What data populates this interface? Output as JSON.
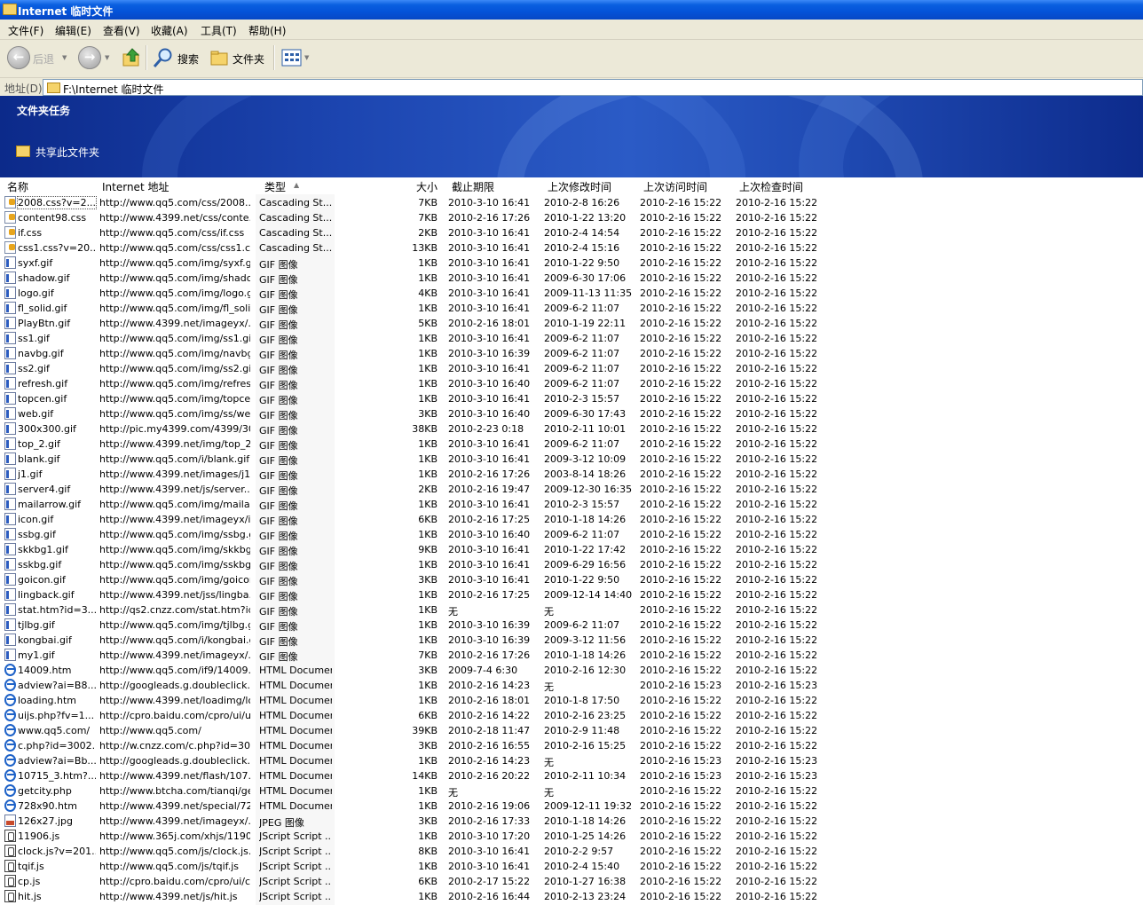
{
  "window": {
    "title": "Internet 临时文件"
  },
  "menu": [
    "文件(F)",
    "编辑(E)",
    "查看(V)",
    "收藏(A)",
    "工具(T)",
    "帮助(H)"
  ],
  "toolbar": {
    "back": "后退",
    "search": "搜索",
    "folders": "文件夹"
  },
  "address": {
    "label": "地址(D)",
    "value": "F:\\Internet 临时文件"
  },
  "tasks": {
    "title": "文件夹任务",
    "share": "共享此文件夹"
  },
  "columns": {
    "name": "名称",
    "address": "Internet 地址",
    "type": "类型",
    "size": "大小",
    "expires": "截止期限",
    "modified": "上次修改时间",
    "accessed": "上次访问时间",
    "checked": "上次检查时间"
  },
  "files": [
    {
      "icon": "css",
      "name": "2008.css?v=2...",
      "address": "http://www.qq5.com/css/2008....",
      "type": "Cascading St...",
      "size": "7KB",
      "expires": "2010-3-10 16:41",
      "modified": "2010-2-8 16:26",
      "accessed": "2010-2-16 15:22",
      "checked": "2010-2-16 15:22"
    },
    {
      "icon": "css",
      "name": "content98.css",
      "address": "http://www.4399.net/css/conte...",
      "type": "Cascading St...",
      "size": "7KB",
      "expires": "2010-2-16 17:26",
      "modified": "2010-1-22 13:20",
      "accessed": "2010-2-16 15:22",
      "checked": "2010-2-16 15:22"
    },
    {
      "icon": "css",
      "name": "if.css",
      "address": "http://www.qq5.com/css/if.css",
      "type": "Cascading St...",
      "size": "2KB",
      "expires": "2010-3-10 16:41",
      "modified": "2010-2-4 14:54",
      "accessed": "2010-2-16 15:22",
      "checked": "2010-2-16 15:22"
    },
    {
      "icon": "css",
      "name": "css1.css?v=20...",
      "address": "http://www.qq5.com/css/css1.c...",
      "type": "Cascading St...",
      "size": "13KB",
      "expires": "2010-3-10 16:41",
      "modified": "2010-2-4 15:16",
      "accessed": "2010-2-16 15:22",
      "checked": "2010-2-16 15:22"
    },
    {
      "icon": "gif",
      "name": "syxf.gif",
      "address": "http://www.qq5.com/img/syxf.gif",
      "type": "GIF 图像",
      "size": "1KB",
      "expires": "2010-3-10 16:41",
      "modified": "2010-1-22 9:50",
      "accessed": "2010-2-16 15:22",
      "checked": "2010-2-16 15:22"
    },
    {
      "icon": "gif",
      "name": "shadow.gif",
      "address": "http://www.qq5.com/img/shado...",
      "type": "GIF 图像",
      "size": "1KB",
      "expires": "2010-3-10 16:41",
      "modified": "2009-6-30 17:06",
      "accessed": "2010-2-16 15:22",
      "checked": "2010-2-16 15:22"
    },
    {
      "icon": "gif",
      "name": "logo.gif",
      "address": "http://www.qq5.com/img/logo.gif",
      "type": "GIF 图像",
      "size": "4KB",
      "expires": "2010-3-10 16:41",
      "modified": "2009-11-13 11:35",
      "accessed": "2010-2-16 15:22",
      "checked": "2010-2-16 15:22"
    },
    {
      "icon": "gif",
      "name": "fl_solid.gif",
      "address": "http://www.qq5.com/img/fl_soli...",
      "type": "GIF 图像",
      "size": "1KB",
      "expires": "2010-3-10 16:41",
      "modified": "2009-6-2 11:07",
      "accessed": "2010-2-16 15:22",
      "checked": "2010-2-16 15:22"
    },
    {
      "icon": "gif",
      "name": "PlayBtn.gif",
      "address": "http://www.4399.net/imageyx/...",
      "type": "GIF 图像",
      "size": "5KB",
      "expires": "2010-2-16 18:01",
      "modified": "2010-1-19 22:11",
      "accessed": "2010-2-16 15:22",
      "checked": "2010-2-16 15:22"
    },
    {
      "icon": "gif",
      "name": "ss1.gif",
      "address": "http://www.qq5.com/img/ss1.gif",
      "type": "GIF 图像",
      "size": "1KB",
      "expires": "2010-3-10 16:41",
      "modified": "2009-6-2 11:07",
      "accessed": "2010-2-16 15:22",
      "checked": "2010-2-16 15:22"
    },
    {
      "icon": "gif",
      "name": "navbg.gif",
      "address": "http://www.qq5.com/img/navbg...",
      "type": "GIF 图像",
      "size": "1KB",
      "expires": "2010-3-10 16:39",
      "modified": "2009-6-2 11:07",
      "accessed": "2010-2-16 15:22",
      "checked": "2010-2-16 15:22"
    },
    {
      "icon": "gif",
      "name": "ss2.gif",
      "address": "http://www.qq5.com/img/ss2.gif",
      "type": "GIF 图像",
      "size": "1KB",
      "expires": "2010-3-10 16:41",
      "modified": "2009-6-2 11:07",
      "accessed": "2010-2-16 15:22",
      "checked": "2010-2-16 15:22"
    },
    {
      "icon": "gif",
      "name": "refresh.gif",
      "address": "http://www.qq5.com/img/refres...",
      "type": "GIF 图像",
      "size": "1KB",
      "expires": "2010-3-10 16:40",
      "modified": "2009-6-2 11:07",
      "accessed": "2010-2-16 15:22",
      "checked": "2010-2-16 15:22"
    },
    {
      "icon": "gif",
      "name": "topcen.gif",
      "address": "http://www.qq5.com/img/topce...",
      "type": "GIF 图像",
      "size": "1KB",
      "expires": "2010-3-10 16:41",
      "modified": "2010-2-3 15:57",
      "accessed": "2010-2-16 15:22",
      "checked": "2010-2-16 15:22"
    },
    {
      "icon": "gif",
      "name": "web.gif",
      "address": "http://www.qq5.com/img/ss/we...",
      "type": "GIF 图像",
      "size": "3KB",
      "expires": "2010-3-10 16:40",
      "modified": "2009-6-30 17:43",
      "accessed": "2010-2-16 15:22",
      "checked": "2010-2-16 15:22"
    },
    {
      "icon": "gif",
      "name": "300x300.gif",
      "address": "http://pic.my4399.com/4399/30...",
      "type": "GIF 图像",
      "size": "38KB",
      "expires": "2010-2-23 0:18",
      "modified": "2010-2-11 10:01",
      "accessed": "2010-2-16 15:22",
      "checked": "2010-2-16 15:22"
    },
    {
      "icon": "gif",
      "name": "top_2.gif",
      "address": "http://www.4399.net/img/top_2...",
      "type": "GIF 图像",
      "size": "1KB",
      "expires": "2010-3-10 16:41",
      "modified": "2009-6-2 11:07",
      "accessed": "2010-2-16 15:22",
      "checked": "2010-2-16 15:22"
    },
    {
      "icon": "gif",
      "name": "blank.gif",
      "address": "http://www.qq5.com/i/blank.gif",
      "type": "GIF 图像",
      "size": "1KB",
      "expires": "2010-3-10 16:41",
      "modified": "2009-3-12 10:09",
      "accessed": "2010-2-16 15:22",
      "checked": "2010-2-16 15:22"
    },
    {
      "icon": "gif",
      "name": "j1.gif",
      "address": "http://www.4399.net/images/j1...",
      "type": "GIF 图像",
      "size": "1KB",
      "expires": "2010-2-16 17:26",
      "modified": "2003-8-14 18:26",
      "accessed": "2010-2-16 15:22",
      "checked": "2010-2-16 15:22"
    },
    {
      "icon": "gif",
      "name": "server4.gif",
      "address": "http://www.4399.net/js/server...",
      "type": "GIF 图像",
      "size": "2KB",
      "expires": "2010-2-16 19:47",
      "modified": "2009-12-30 16:35",
      "accessed": "2010-2-16 15:22",
      "checked": "2010-2-16 15:22"
    },
    {
      "icon": "gif",
      "name": "mailarrow.gif",
      "address": "http://www.qq5.com/img/mailar...",
      "type": "GIF 图像",
      "size": "1KB",
      "expires": "2010-3-10 16:41",
      "modified": "2010-2-3 15:57",
      "accessed": "2010-2-16 15:22",
      "checked": "2010-2-16 15:22"
    },
    {
      "icon": "gif",
      "name": "icon.gif",
      "address": "http://www.4399.net/imageyx/i...",
      "type": "GIF 图像",
      "size": "6KB",
      "expires": "2010-2-16 17:25",
      "modified": "2010-1-18 14:26",
      "accessed": "2010-2-16 15:22",
      "checked": "2010-2-16 15:22"
    },
    {
      "icon": "gif",
      "name": "ssbg.gif",
      "address": "http://www.qq5.com/img/ssbg.gif",
      "type": "GIF 图像",
      "size": "1KB",
      "expires": "2010-3-10 16:40",
      "modified": "2009-6-2 11:07",
      "accessed": "2010-2-16 15:22",
      "checked": "2010-2-16 15:22"
    },
    {
      "icon": "gif",
      "name": "skkbg1.gif",
      "address": "http://www.qq5.com/img/skkbg...",
      "type": "GIF 图像",
      "size": "9KB",
      "expires": "2010-3-10 16:41",
      "modified": "2010-1-22 17:42",
      "accessed": "2010-2-16 15:22",
      "checked": "2010-2-16 15:22"
    },
    {
      "icon": "gif",
      "name": "sskbg.gif",
      "address": "http://www.qq5.com/img/sskbg.gif",
      "type": "GIF 图像",
      "size": "1KB",
      "expires": "2010-3-10 16:41",
      "modified": "2009-6-29 16:56",
      "accessed": "2010-2-16 15:22",
      "checked": "2010-2-16 15:22"
    },
    {
      "icon": "gif",
      "name": "goicon.gif",
      "address": "http://www.qq5.com/img/goicon...",
      "type": "GIF 图像",
      "size": "3KB",
      "expires": "2010-3-10 16:41",
      "modified": "2010-1-22 9:50",
      "accessed": "2010-2-16 15:22",
      "checked": "2010-2-16 15:22"
    },
    {
      "icon": "gif",
      "name": "lingback.gif",
      "address": "http://www.4399.net/jss/lingba...",
      "type": "GIF 图像",
      "size": "1KB",
      "expires": "2010-2-16 17:25",
      "modified": "2009-12-14 14:40",
      "accessed": "2010-2-16 15:22",
      "checked": "2010-2-16 15:22"
    },
    {
      "icon": "gif",
      "name": "stat.htm?id=3...",
      "address": "http://qs2.cnzz.com/stat.htm?id...",
      "type": "GIF 图像",
      "size": "1KB",
      "expires": "无",
      "modified": "无",
      "accessed": "2010-2-16 15:22",
      "checked": "2010-2-16 15:22"
    },
    {
      "icon": "gif",
      "name": "tjlbg.gif",
      "address": "http://www.qq5.com/img/tjlbg.gif",
      "type": "GIF 图像",
      "size": "1KB",
      "expires": "2010-3-10 16:39",
      "modified": "2009-6-2 11:07",
      "accessed": "2010-2-16 15:22",
      "checked": "2010-2-16 15:22"
    },
    {
      "icon": "gif",
      "name": "kongbai.gif",
      "address": "http://www.qq5.com/i/kongbai.gif",
      "type": "GIF 图像",
      "size": "1KB",
      "expires": "2010-3-10 16:39",
      "modified": "2009-3-12 11:56",
      "accessed": "2010-2-16 15:22",
      "checked": "2010-2-16 15:22"
    },
    {
      "icon": "gif",
      "name": "my1.gif",
      "address": "http://www.4399.net/imageyx/...",
      "type": "GIF 图像",
      "size": "7KB",
      "expires": "2010-2-16 17:26",
      "modified": "2010-1-18 14:26",
      "accessed": "2010-2-16 15:22",
      "checked": "2010-2-16 15:22"
    },
    {
      "icon": "htm",
      "name": "14009.htm",
      "address": "http://www.qq5.com/if9/14009....",
      "type": "HTML Document",
      "size": "3KB",
      "expires": "2009-7-4 6:30",
      "modified": "2010-2-16 12:30",
      "accessed": "2010-2-16 15:22",
      "checked": "2010-2-16 15:22"
    },
    {
      "icon": "htm",
      "name": "adview?ai=B8...",
      "address": "http://googleads.g.doubleclick.n...",
      "type": "HTML Document",
      "size": "1KB",
      "expires": "2010-2-16 14:23",
      "modified": "无",
      "accessed": "2010-2-16 15:23",
      "checked": "2010-2-16 15:23"
    },
    {
      "icon": "htm",
      "name": "loading.htm",
      "address": "http://www.4399.net/loadimg/lo...",
      "type": "HTML Document",
      "size": "1KB",
      "expires": "2010-2-16 18:01",
      "modified": "2010-1-8 17:50",
      "accessed": "2010-2-16 15:22",
      "checked": "2010-2-16 15:22"
    },
    {
      "icon": "htm",
      "name": "uijs.php?fv=1...",
      "address": "http://cpro.baidu.com/cpro/ui/ui...",
      "type": "HTML Document",
      "size": "6KB",
      "expires": "2010-2-16 14:22",
      "modified": "2010-2-16 23:25",
      "accessed": "2010-2-16 15:22",
      "checked": "2010-2-16 15:22"
    },
    {
      "icon": "htm",
      "name": "www.qq5.com/",
      "address": "http://www.qq5.com/",
      "type": "HTML Document",
      "size": "39KB",
      "expires": "2010-2-18 11:47",
      "modified": "2010-2-9 11:48",
      "accessed": "2010-2-16 15:22",
      "checked": "2010-2-16 15:22"
    },
    {
      "icon": "htm",
      "name": "c.php?id=3002...",
      "address": "http://w.cnzz.com/c.php?id=30...",
      "type": "HTML Document",
      "size": "3KB",
      "expires": "2010-2-16 16:55",
      "modified": "2010-2-16 15:25",
      "accessed": "2010-2-16 15:22",
      "checked": "2010-2-16 15:22"
    },
    {
      "icon": "htm",
      "name": "adview?ai=Bb...",
      "address": "http://googleads.g.doubleclick.n...",
      "type": "HTML Document",
      "size": "1KB",
      "expires": "2010-2-16 14:23",
      "modified": "无",
      "accessed": "2010-2-16 15:23",
      "checked": "2010-2-16 15:23"
    },
    {
      "icon": "htm",
      "name": "10715_3.htm?...",
      "address": "http://www.4399.net/flash/107...",
      "type": "HTML Document",
      "size": "14KB",
      "expires": "2010-2-16 20:22",
      "modified": "2010-2-11 10:34",
      "accessed": "2010-2-16 15:23",
      "checked": "2010-2-16 15:23"
    },
    {
      "icon": "htm",
      "name": "getcity.php",
      "address": "http://www.btcha.com/tianqi/ge...",
      "type": "HTML Document",
      "size": "1KB",
      "expires": "无",
      "modified": "无",
      "accessed": "2010-2-16 15:22",
      "checked": "2010-2-16 15:22"
    },
    {
      "icon": "htm",
      "name": "728x90.htm",
      "address": "http://www.4399.net/special/72...",
      "type": "HTML Document",
      "size": "1KB",
      "expires": "2010-2-16 19:06",
      "modified": "2009-12-11 19:32",
      "accessed": "2010-2-16 15:22",
      "checked": "2010-2-16 15:22"
    },
    {
      "icon": "jpg",
      "name": "126x27.jpg",
      "address": "http://www.4399.net/imageyx/...",
      "type": "JPEG 图像",
      "size": "3KB",
      "expires": "2010-2-16 17:33",
      "modified": "2010-1-18 14:26",
      "accessed": "2010-2-16 15:22",
      "checked": "2010-2-16 15:22"
    },
    {
      "icon": "js",
      "name": "11906.js",
      "address": "http://www.365j.com/xhjs/1190...",
      "type": "JScript Script ...",
      "size": "1KB",
      "expires": "2010-3-10 17:20",
      "modified": "2010-1-25 14:26",
      "accessed": "2010-2-16 15:22",
      "checked": "2010-2-16 15:22"
    },
    {
      "icon": "js",
      "name": "clock.js?v=201...",
      "address": "http://www.qq5.com/js/clock.js...",
      "type": "JScript Script ...",
      "size": "8KB",
      "expires": "2010-3-10 16:41",
      "modified": "2010-2-2 9:57",
      "accessed": "2010-2-16 15:22",
      "checked": "2010-2-16 15:22"
    },
    {
      "icon": "js",
      "name": "tqif.js",
      "address": "http://www.qq5.com/js/tqif.js",
      "type": "JScript Script ...",
      "size": "1KB",
      "expires": "2010-3-10 16:41",
      "modified": "2010-2-4 15:40",
      "accessed": "2010-2-16 15:22",
      "checked": "2010-2-16 15:22"
    },
    {
      "icon": "js",
      "name": "cp.js",
      "address": "http://cpro.baidu.com/cpro/ui/c...",
      "type": "JScript Script ...",
      "size": "6KB",
      "expires": "2010-2-17 15:22",
      "modified": "2010-1-27 16:38",
      "accessed": "2010-2-16 15:22",
      "checked": "2010-2-16 15:22"
    },
    {
      "icon": "js",
      "name": "hit.js",
      "address": "http://www.4399.net/js/hit.js",
      "type": "JScript Script ...",
      "size": "1KB",
      "expires": "2010-2-16 16:44",
      "modified": "2010-2-13 23:24",
      "accessed": "2010-2-16 15:22",
      "checked": "2010-2-16 15:22"
    }
  ]
}
